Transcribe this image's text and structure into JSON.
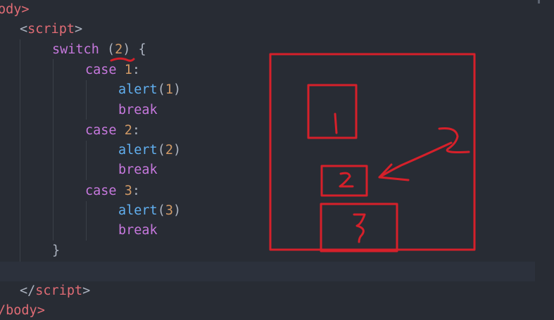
{
  "code": {
    "body_open": "ody>",
    "script_open_lt": "<",
    "script_open_name": "script",
    "script_open_gt": ">",
    "switch_kw": "switch",
    "switch_open": " (",
    "switch_value": "2",
    "switch_close": ") {",
    "case1_kw": "case",
    "case1_num": "1",
    "case1_colon": ":",
    "alert1_fn": "alert",
    "alert1_open": "(",
    "alert1_num": "1",
    "alert1_close": ")",
    "break1_kw": "break",
    "case2_kw": "case",
    "case2_num": "2",
    "case2_colon": ":",
    "alert2_fn": "alert",
    "alert2_open": "(",
    "alert2_num": "2",
    "alert2_close": ")",
    "break2_kw": "break",
    "case3_kw": "case",
    "case3_num": "3",
    "case3_colon": ":",
    "alert3_fn": "alert",
    "alert3_open": "(",
    "alert3_num": "3",
    "alert3_close": ")",
    "break3_kw": "break",
    "brace_close": "}",
    "script_close_lt": "</",
    "script_close_name": "script",
    "script_close_gt": ">",
    "body_close": "/body>"
  },
  "annotations": {
    "box1_label": "1",
    "box2_label": "2",
    "box3_label": "3",
    "arrow_label": "2"
  },
  "colors": {
    "background": "#282c34",
    "tag": "#e06c75",
    "keyword": "#c678dd",
    "number": "#d19a66",
    "function": "#61afef",
    "punctuation": "#abb2bf",
    "ink": "#d6202a"
  }
}
